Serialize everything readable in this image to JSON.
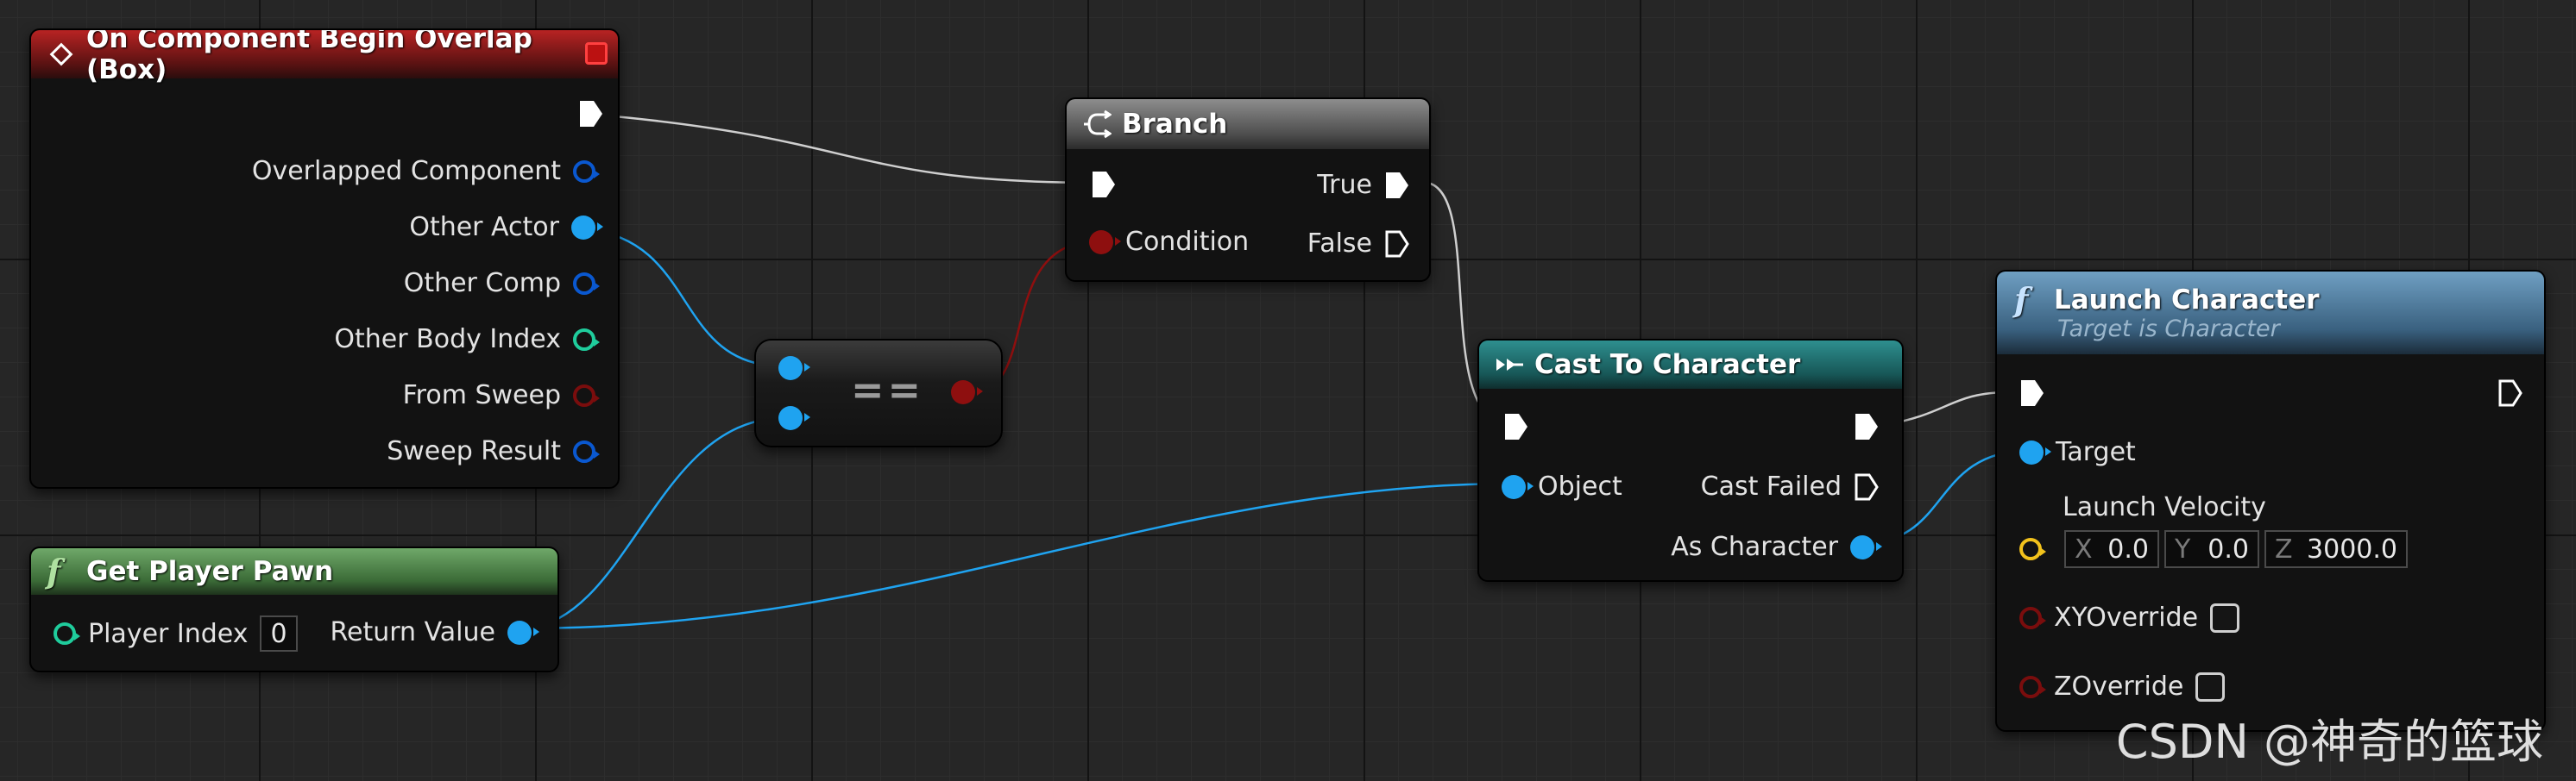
{
  "nodes": {
    "overlap_event": {
      "title": "On Component Begin Overlap (Box)",
      "outputs": [
        "Overlapped Component",
        "Other Actor",
        "Other Comp",
        "Other Body Index",
        "From Sweep",
        "Sweep Result"
      ]
    },
    "branch": {
      "title": "Branch",
      "condition_label": "Condition",
      "true_label": "True",
      "false_label": "False"
    },
    "equals": {
      "symbol": "=="
    },
    "get_player_pawn": {
      "title": "Get Player Pawn",
      "player_index_label": "Player Index",
      "player_index_value": "0",
      "return_label": "Return Value"
    },
    "cast": {
      "title": "Cast To Character",
      "object_label": "Object",
      "cast_failed_label": "Cast Failed",
      "as_character_label": "As Character"
    },
    "launch": {
      "title": "Launch Character",
      "subtitle": "Target is Character",
      "target_label": "Target",
      "velocity_label": "Launch Velocity",
      "x_label": "X",
      "x_value": "0.0",
      "y_label": "Y",
      "y_value": "0.0",
      "z_label": "Z",
      "z_value": "3000.0",
      "xy_override_label": "XYOverride",
      "z_override_label": "ZOverride"
    }
  },
  "watermark": "CSDN @神奇的篮球",
  "colors": {
    "object_pin": "#1fa3f0",
    "bool_pin": "#8e0f0f",
    "int_pin": "#1fcc9c",
    "vector_pin": "#f2c21c",
    "struct_pin": "#0a58d0",
    "exec_wire": "#d8d8d8"
  },
  "icons": [
    "event-diamond-icon",
    "stop-icon",
    "branch-icon",
    "function-icon",
    "cast-arrows-icon",
    "exec-pin-icon"
  ]
}
